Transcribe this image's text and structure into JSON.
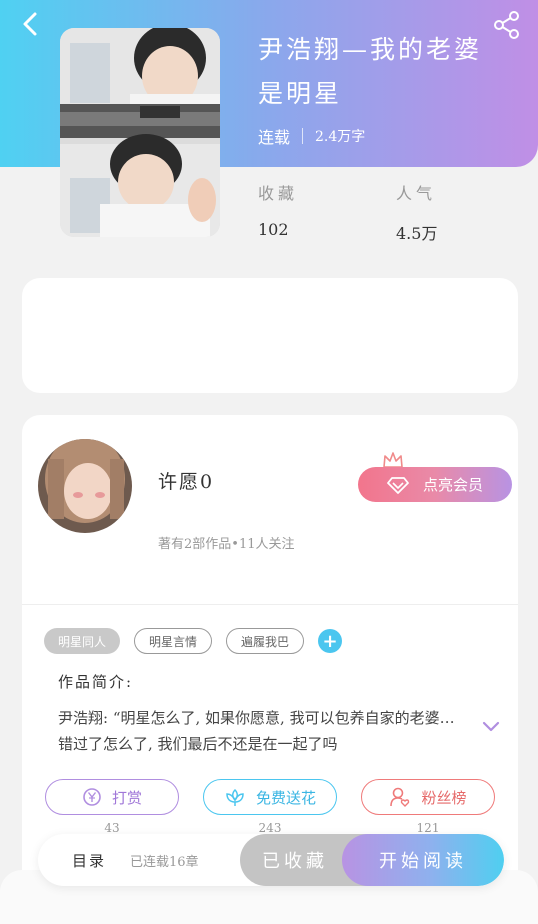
{
  "book": {
    "title": "尹浩翔—我的老婆是明星",
    "status": "连载",
    "word_count": "2.4万字",
    "favorites_label": "收藏",
    "favorites_value": "102",
    "popularity_label": "人气",
    "popularity_value": "4.5万"
  },
  "author": {
    "name": "许愿0",
    "meta": "著有2部作品•11人关注",
    "vip_button": "点亮会员"
  },
  "tags": [
    "明星同人",
    "明星言情",
    "遍履我巴"
  ],
  "intro": {
    "label": "作品简介:",
    "text": "尹浩翔: “明星怎么了, 如果你愿意, 我可以包养自家的老婆…错过了怎么了, 我们最后不还是在一起了吗"
  },
  "actions": {
    "tip": {
      "label": "打赏",
      "count": "43"
    },
    "flower": {
      "label": "免费送花",
      "count": "243"
    },
    "fans": {
      "label": "粉丝榜",
      "count": "121"
    }
  },
  "bottom_bar": {
    "toc_label": "目录",
    "toc_status": "已连载16章",
    "favorite_button": "已收藏",
    "read_button": "开始阅读"
  },
  "colors": {
    "header_gradient": [
      "#4fd1f2",
      "#c08fe6"
    ],
    "vip_gradient": [
      "#f2758c",
      "#b893e3"
    ],
    "tip": "#b08ee0",
    "flower": "#4bc6ef",
    "fans": "#ef7a7a",
    "plus_button": "#4bc6ef"
  },
  "icons": [
    "back-icon",
    "share-icon",
    "crown-icon",
    "diamond-icon",
    "plus-icon",
    "chevron-down-icon",
    "yen-coin-icon",
    "flower-icon",
    "user-heart-icon"
  ]
}
